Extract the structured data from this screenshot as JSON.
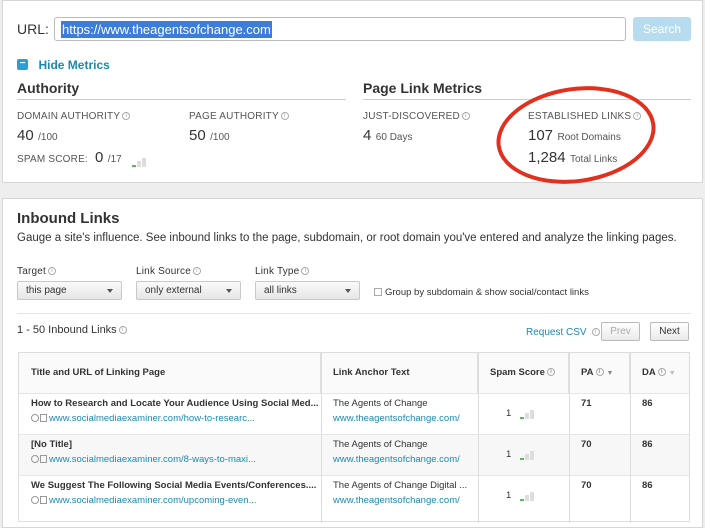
{
  "search": {
    "url_label": "URL:",
    "url_value": "https://www.theagentsofchange.com",
    "search_label": "Search"
  },
  "metrics_toggle": {
    "icon": "minus",
    "label": "Hide Metrics"
  },
  "authority": {
    "title": "Authority",
    "domain_authority": {
      "label": "DOMAIN AUTHORITY",
      "value": "40",
      "suffix": "/100"
    },
    "page_authority": {
      "label": "PAGE AUTHORITY",
      "value": "50",
      "suffix": "/100"
    },
    "spam_score": {
      "label": "SPAM SCORE:",
      "value": "0",
      "suffix": "/17"
    }
  },
  "page_link_metrics": {
    "title": "Page Link Metrics",
    "just_discovered": {
      "label": "JUST-DISCOVERED",
      "value": "4",
      "suffix": "60 Days"
    },
    "established_links": {
      "label": "ESTABLISHED LINKS",
      "root_domains": {
        "value": "107",
        "suffix": "Root Domains"
      },
      "total_links": {
        "value": "1,284",
        "suffix": "Total Links"
      }
    }
  },
  "inbound": {
    "title": "Inbound Links",
    "description": "Gauge a site's influence. See inbound links to the page, subdomain, or root domain you've entered and analyze the linking pages.",
    "filters": {
      "target": {
        "label": "Target",
        "value": "this page"
      },
      "link_source": {
        "label": "Link Source",
        "value": "only external"
      },
      "link_type": {
        "label": "Link Type",
        "value": "all links"
      },
      "group_checkbox_label": "Group by subdomain & show social/contact links"
    },
    "range_label": "1 - 50 Inbound Links",
    "request_csv": "Request CSV",
    "prev_label": "Prev",
    "next_label": "Next",
    "columns": [
      "Title and URL of Linking Page",
      "Link Anchor Text",
      "Spam Score",
      "PA",
      "DA"
    ],
    "rows": [
      {
        "title": "How to Research and Locate Your Audience Using Social Med...",
        "url": "www.socialmediaexaminer.com/how-to-researc...",
        "anchor": "The Agents of Change",
        "anchor_url": "www.theagentsofchange.com/",
        "spam": "1",
        "pa": "71",
        "da": "86"
      },
      {
        "title": "[No Title]",
        "url": "www.socialmediaexaminer.com/8-ways-to-maxi...",
        "anchor": "The Agents of Change",
        "anchor_url": "www.theagentsofchange.com/",
        "spam": "1",
        "pa": "70",
        "da": "86"
      },
      {
        "title": "We Suggest The Following Social Media Events/Conferences....",
        "url": "www.socialmediaexaminer.com/upcoming-even...",
        "anchor": "The Agents of Change Digital ...",
        "anchor_url": "www.theagentsofchange.com/",
        "spam": "1",
        "pa": "70",
        "da": "86"
      }
    ]
  },
  "colors": {
    "accent": "#1a8ab5",
    "highlight": "#e2301f",
    "spam_green": "#5cb85c"
  }
}
